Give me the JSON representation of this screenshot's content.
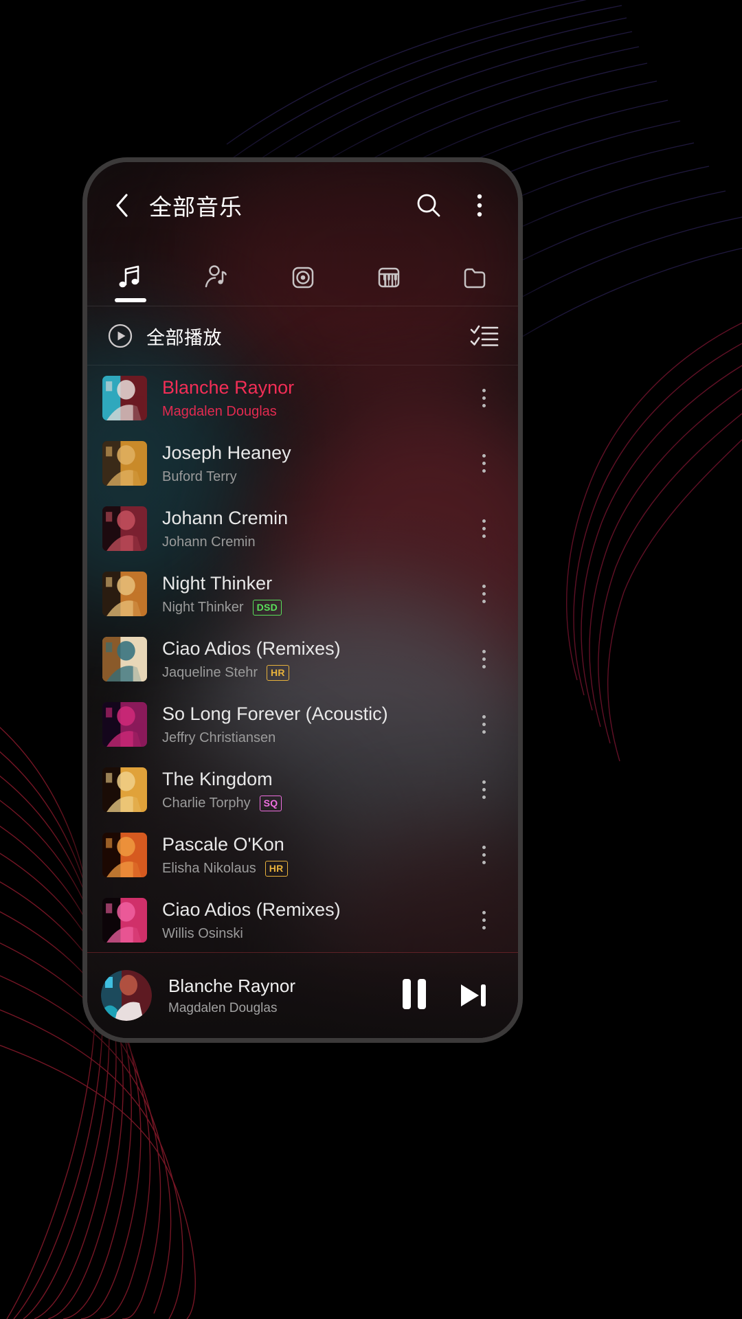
{
  "header": {
    "title": "全部音乐",
    "back_icon": "chevron-left-icon",
    "search_icon": "search-icon",
    "overflow_icon": "more-vertical-icon"
  },
  "tabs": [
    {
      "name": "songs",
      "icon": "music-note-icon",
      "active": true
    },
    {
      "name": "artists",
      "icon": "artist-icon",
      "active": false
    },
    {
      "name": "albums",
      "icon": "album-disc-icon",
      "active": false
    },
    {
      "name": "genres",
      "icon": "piano-keys-icon",
      "active": false
    },
    {
      "name": "folders",
      "icon": "folder-icon",
      "active": false
    }
  ],
  "play_all": {
    "label": "全部播放",
    "play_icon": "play-circle-icon",
    "multiselect_icon": "checklist-icon"
  },
  "songs": [
    {
      "title": "Blanche Raynor",
      "artist": "Magdalen Douglas",
      "badge": "",
      "active": true
    },
    {
      "title": "Joseph Heaney",
      "artist": "Buford Terry",
      "badge": "",
      "active": false
    },
    {
      "title": "Johann Cremin",
      "artist": "Johann Cremin",
      "badge": "",
      "active": false
    },
    {
      "title": "Night Thinker",
      "artist": "Night Thinker",
      "badge": "DSD",
      "active": false
    },
    {
      "title": "Ciao Adios (Remixes)",
      "artist": "Jaqueline Stehr",
      "badge": "HR",
      "active": false
    },
    {
      "title": "So Long Forever (Acoustic)",
      "artist": "Jeffry Christiansen",
      "badge": "",
      "active": false
    },
    {
      "title": "The Kingdom",
      "artist": "Charlie Torphy",
      "badge": "SQ",
      "active": false
    },
    {
      "title": "Pascale O'Kon",
      "artist": "Elisha Nikolaus",
      "badge": "HR",
      "active": false
    },
    {
      "title": "Ciao Adios (Remixes)",
      "artist": "Willis Osinski",
      "badge": "",
      "active": false
    }
  ],
  "badge_colors": {
    "DSD": "#5ae05a",
    "HR": "#e8b23c",
    "SQ": "#ef6fe0"
  },
  "now_playing": {
    "title": "Blanche Raynor",
    "artist": "Magdalen Douglas",
    "pause_icon": "pause-icon",
    "next_icon": "skip-next-icon"
  },
  "colors": {
    "accent": "#f22e56",
    "text_primary": "#e8e8e8",
    "text_secondary": "#9b9b9b"
  }
}
